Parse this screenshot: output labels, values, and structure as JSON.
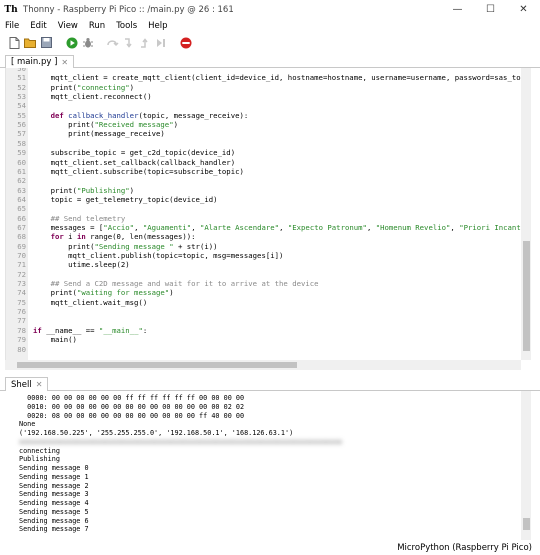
{
  "window": {
    "title": "Thonny  -  Raspberry Pi Pico :: /main.py  @  26 : 161",
    "minimize": "—",
    "maximize": "☐",
    "close": "✕"
  },
  "menu": [
    "File",
    "Edit",
    "View",
    "Run",
    "Tools",
    "Help"
  ],
  "toolbar": [
    "new-file",
    "open-file",
    "save-file",
    "run",
    "debug",
    "step-over",
    "step-into",
    "step-out",
    "resume",
    "stop"
  ],
  "editor": {
    "tab_label": "[ main.py ]",
    "tab_close": "✕",
    "lines": [
      {
        "n": "50",
        "t": ""
      },
      {
        "n": "51",
        "t": "    mqtt_client = create_mqtt_client(client_id=device_id, hostname=hostname, username=username, password=sas_to"
      },
      {
        "n": "52",
        "t": "    print(\"connecting\")"
      },
      {
        "n": "53",
        "t": "    mqtt_client.reconnect()"
      },
      {
        "n": "54",
        "t": ""
      },
      {
        "n": "55",
        "t": "    def callback_handler(topic, message_receive):"
      },
      {
        "n": "56",
        "t": "        print(\"Received message\")"
      },
      {
        "n": "57",
        "t": "        print(message_receive)"
      },
      {
        "n": "58",
        "t": ""
      },
      {
        "n": "59",
        "t": "    subscribe_topic = get_c2d_topic(device_id)"
      },
      {
        "n": "60",
        "t": "    mqtt_client.set_callback(callback_handler)"
      },
      {
        "n": "61",
        "t": "    mqtt_client.subscribe(topic=subscribe_topic)"
      },
      {
        "n": "62",
        "t": ""
      },
      {
        "n": "63",
        "t": "    print(\"Publishing\")"
      },
      {
        "n": "64",
        "t": "    topic = get_telemetry_topic(device_id)"
      },
      {
        "n": "65",
        "t": ""
      },
      {
        "n": "66",
        "t": "    ## Send telemetry"
      },
      {
        "n": "67",
        "t": "    messages = [\"Accio\", \"Aguamenti\", \"Alarte Ascendare\", \"Expecto Patronum\", \"Homenum Revelio\", \"Priori Incant"
      },
      {
        "n": "68",
        "t": "    for i in range(0, len(messages)):"
      },
      {
        "n": "69",
        "t": "        print(\"Sending message \" + str(i))"
      },
      {
        "n": "70",
        "t": "        mqtt_client.publish(topic=topic, msg=messages[i])"
      },
      {
        "n": "71",
        "t": "        utime.sleep(2)"
      },
      {
        "n": "72",
        "t": ""
      },
      {
        "n": "73",
        "t": "    ## Send a C2D message and wait for it to arrive at the device"
      },
      {
        "n": "74",
        "t": "    print(\"waiting for message\")"
      },
      {
        "n": "75",
        "t": "    mqtt_client.wait_msg()"
      },
      {
        "n": "76",
        "t": ""
      },
      {
        "n": "77",
        "t": ""
      },
      {
        "n": "78",
        "t": "if __name__ == \"__main__\":"
      },
      {
        "n": "79",
        "t": "    main()"
      },
      {
        "n": "80",
        "t": ""
      }
    ]
  },
  "shell": {
    "tab_label": "Shell",
    "tab_close": "✕",
    "lines": [
      "  0000: 00 00 00 00 00 00 ff ff ff ff ff ff 00 00 00 00",
      "  0010: 00 00 00 00 00 00 00 00 00 00 00 00 00 00 02 02",
      "  0020: 08 00 00 00 00 00 00 00 00 00 00 00 ff 40 00 00",
      "None",
      "('192.168.50.225', '255.255.255.0', '192.168.50.1', '168.126.63.1')",
      "xxxxxxxxxxxxxxxxxxxxxxxxxxxxxxxxxxxxxxxxxxxxxxxxxxxxxxxxxxxxxxxxxxxxxxxxxxxxxxx",
      "connecting",
      "Publishing",
      "Sending message 0",
      "Sending message 1",
      "Sending message 2",
      "Sending message 3",
      "Sending message 4",
      "Sending message 5",
      "Sending message 6",
      "Sending message 7"
    ]
  },
  "status": {
    "interpreter": "MicroPython (Raspberry Pi Pico)"
  }
}
